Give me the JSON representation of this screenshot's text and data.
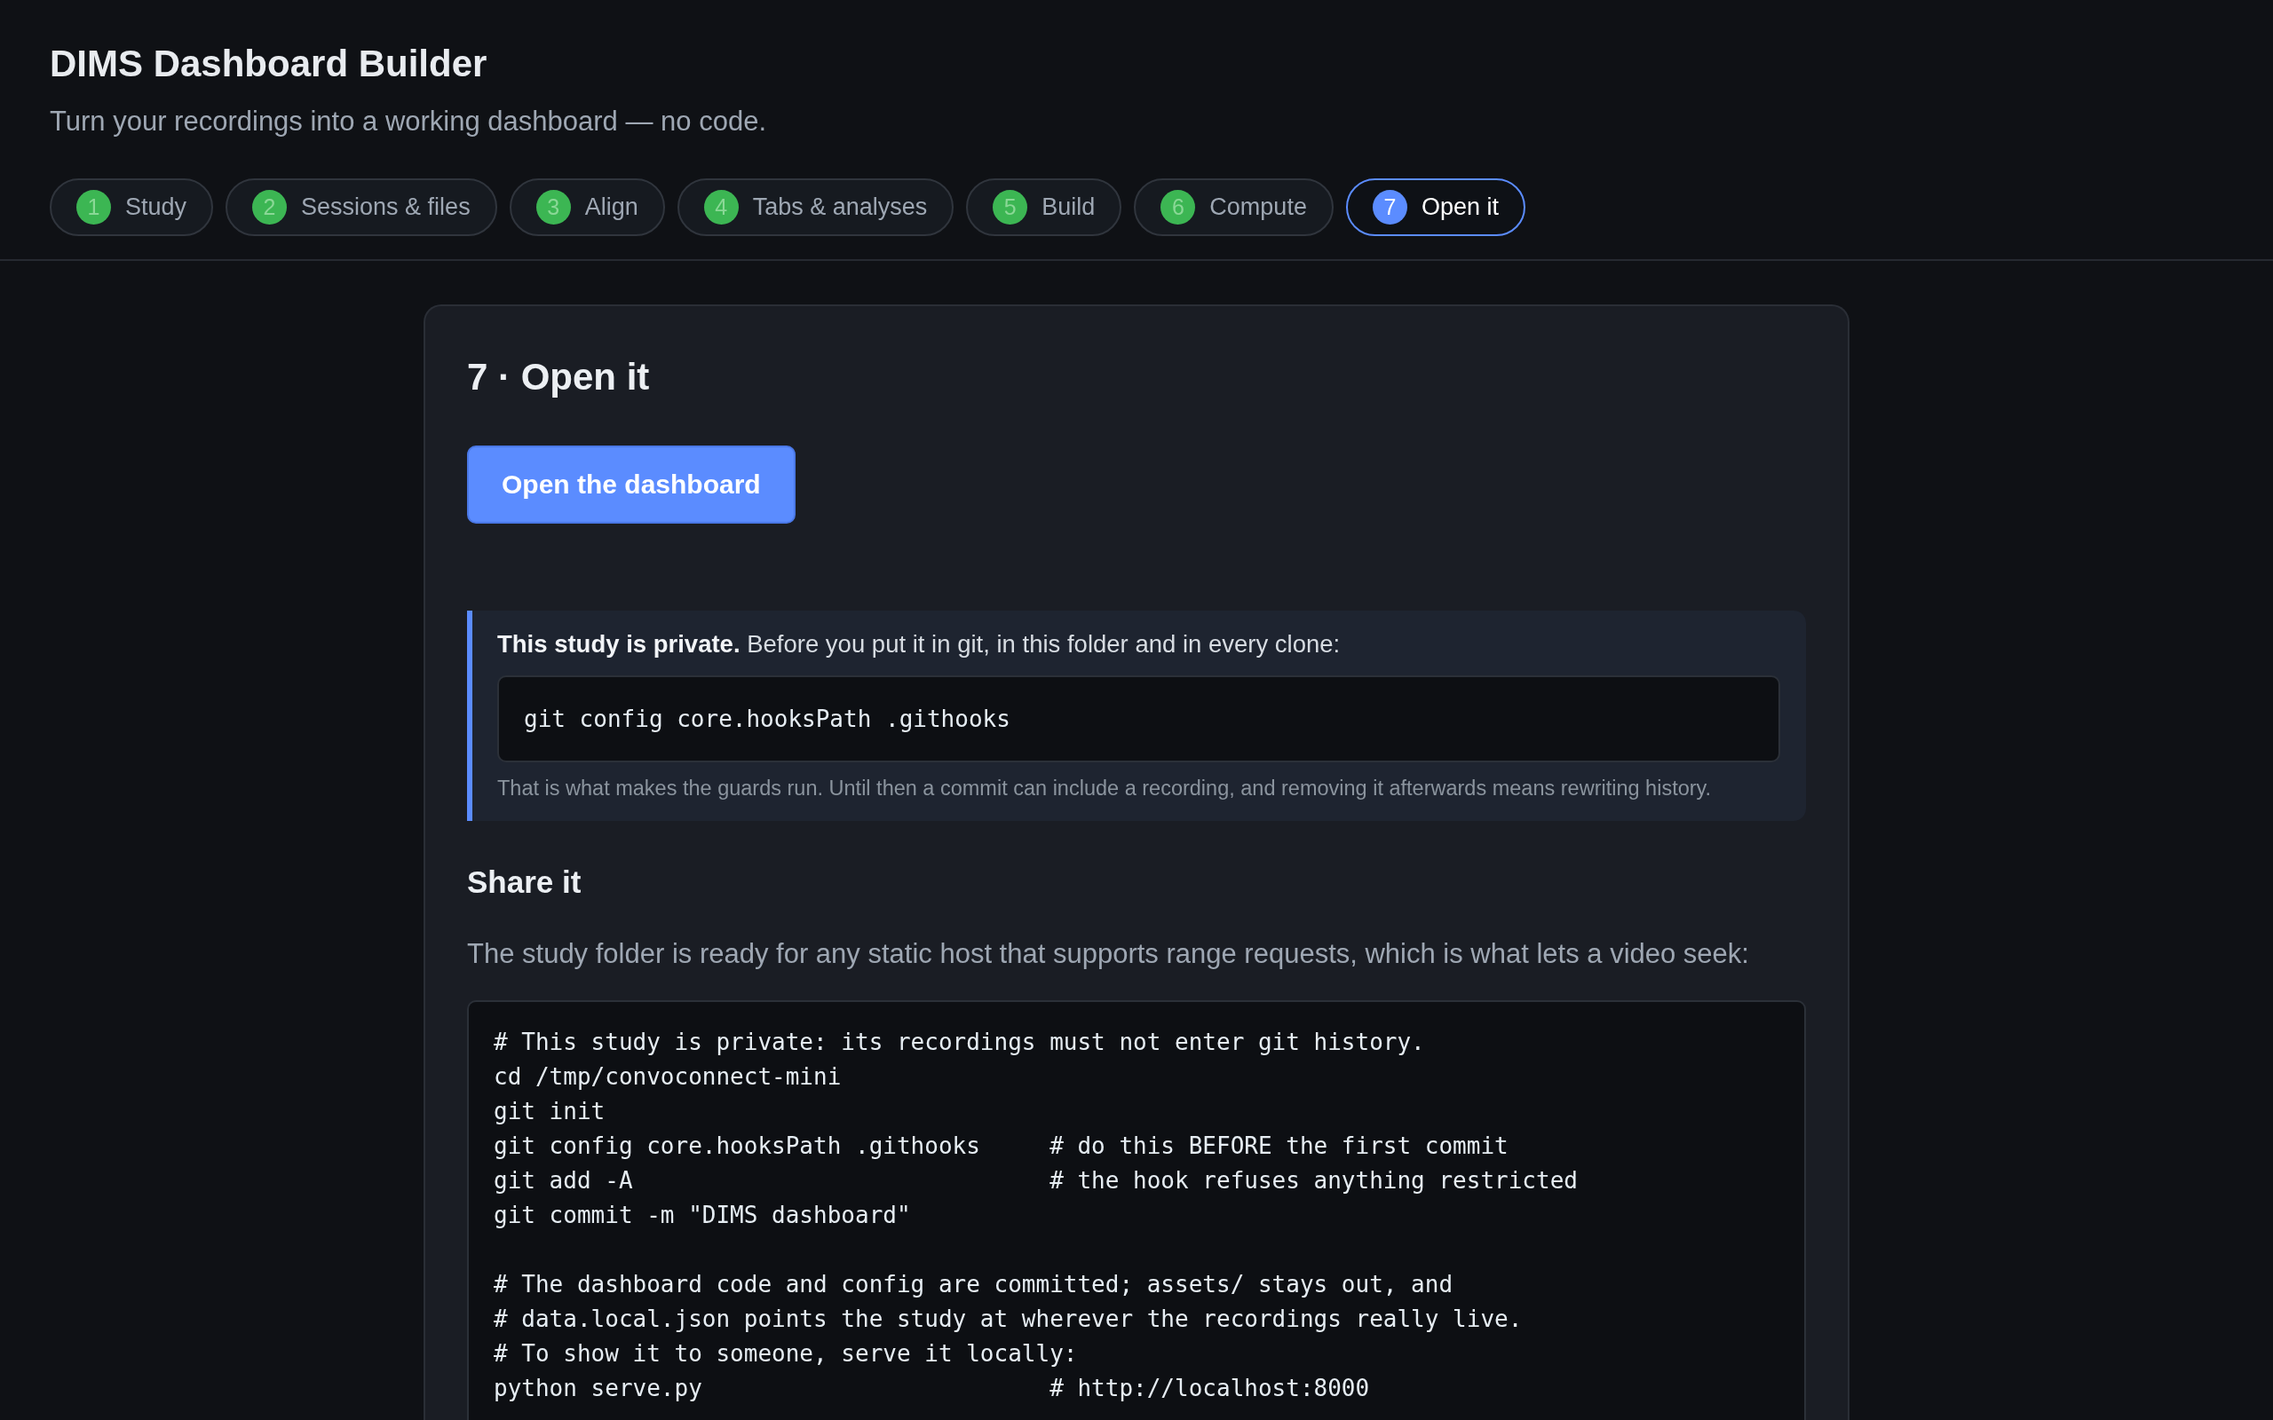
{
  "app": {
    "title": "DIMS Dashboard Builder",
    "subtitle": "Turn your recordings into a working dashboard — no code."
  },
  "steps": [
    {
      "number": "1",
      "label": "Study",
      "done": true,
      "selected": false
    },
    {
      "number": "2",
      "label": "Sessions & files",
      "done": true,
      "selected": false
    },
    {
      "number": "3",
      "label": "Align",
      "done": true,
      "selected": false
    },
    {
      "number": "4",
      "label": "Tabs & analyses",
      "done": true,
      "selected": false
    },
    {
      "number": "5",
      "label": "Build",
      "done": true,
      "selected": false
    },
    {
      "number": "6",
      "label": "Compute",
      "done": true,
      "selected": false
    },
    {
      "number": "7",
      "label": "Open it",
      "done": false,
      "selected": true
    }
  ],
  "panel": {
    "heading": "7 · Open it",
    "open_button": "Open the dashboard",
    "notice": {
      "text": "**This study is private.** Before you put it in git, in this folder and in every clone:",
      "command": "git config core.hooksPath .githooks",
      "note": "That is what makes the guards run. Until then a commit can include a recording, and removing it afterwards means rewriting history."
    },
    "share": {
      "heading": "Share it",
      "text": "The study folder is ready for any static host that supports range requests, which is what lets a video seek:",
      "code_sections": [
        [
          "# This study is private: its recordings must not enter git history.",
          "cd /tmp/convoconnect-mini",
          "git init",
          "git config core.hooksPath .githooks     # do this BEFORE the first commit",
          "git add -A                              # the hook refuses anything restricted",
          "git commit -m \"DIMS dashboard\""
        ],
        [
          "# The dashboard code and config are committed; assets/ stays out, and",
          "# data.local.json points the study at wherever the recordings really live.",
          "# To show it to someone, serve it locally:",
          "python serve.py                         # http://localhost:8000"
        ]
      ]
    }
  }
}
